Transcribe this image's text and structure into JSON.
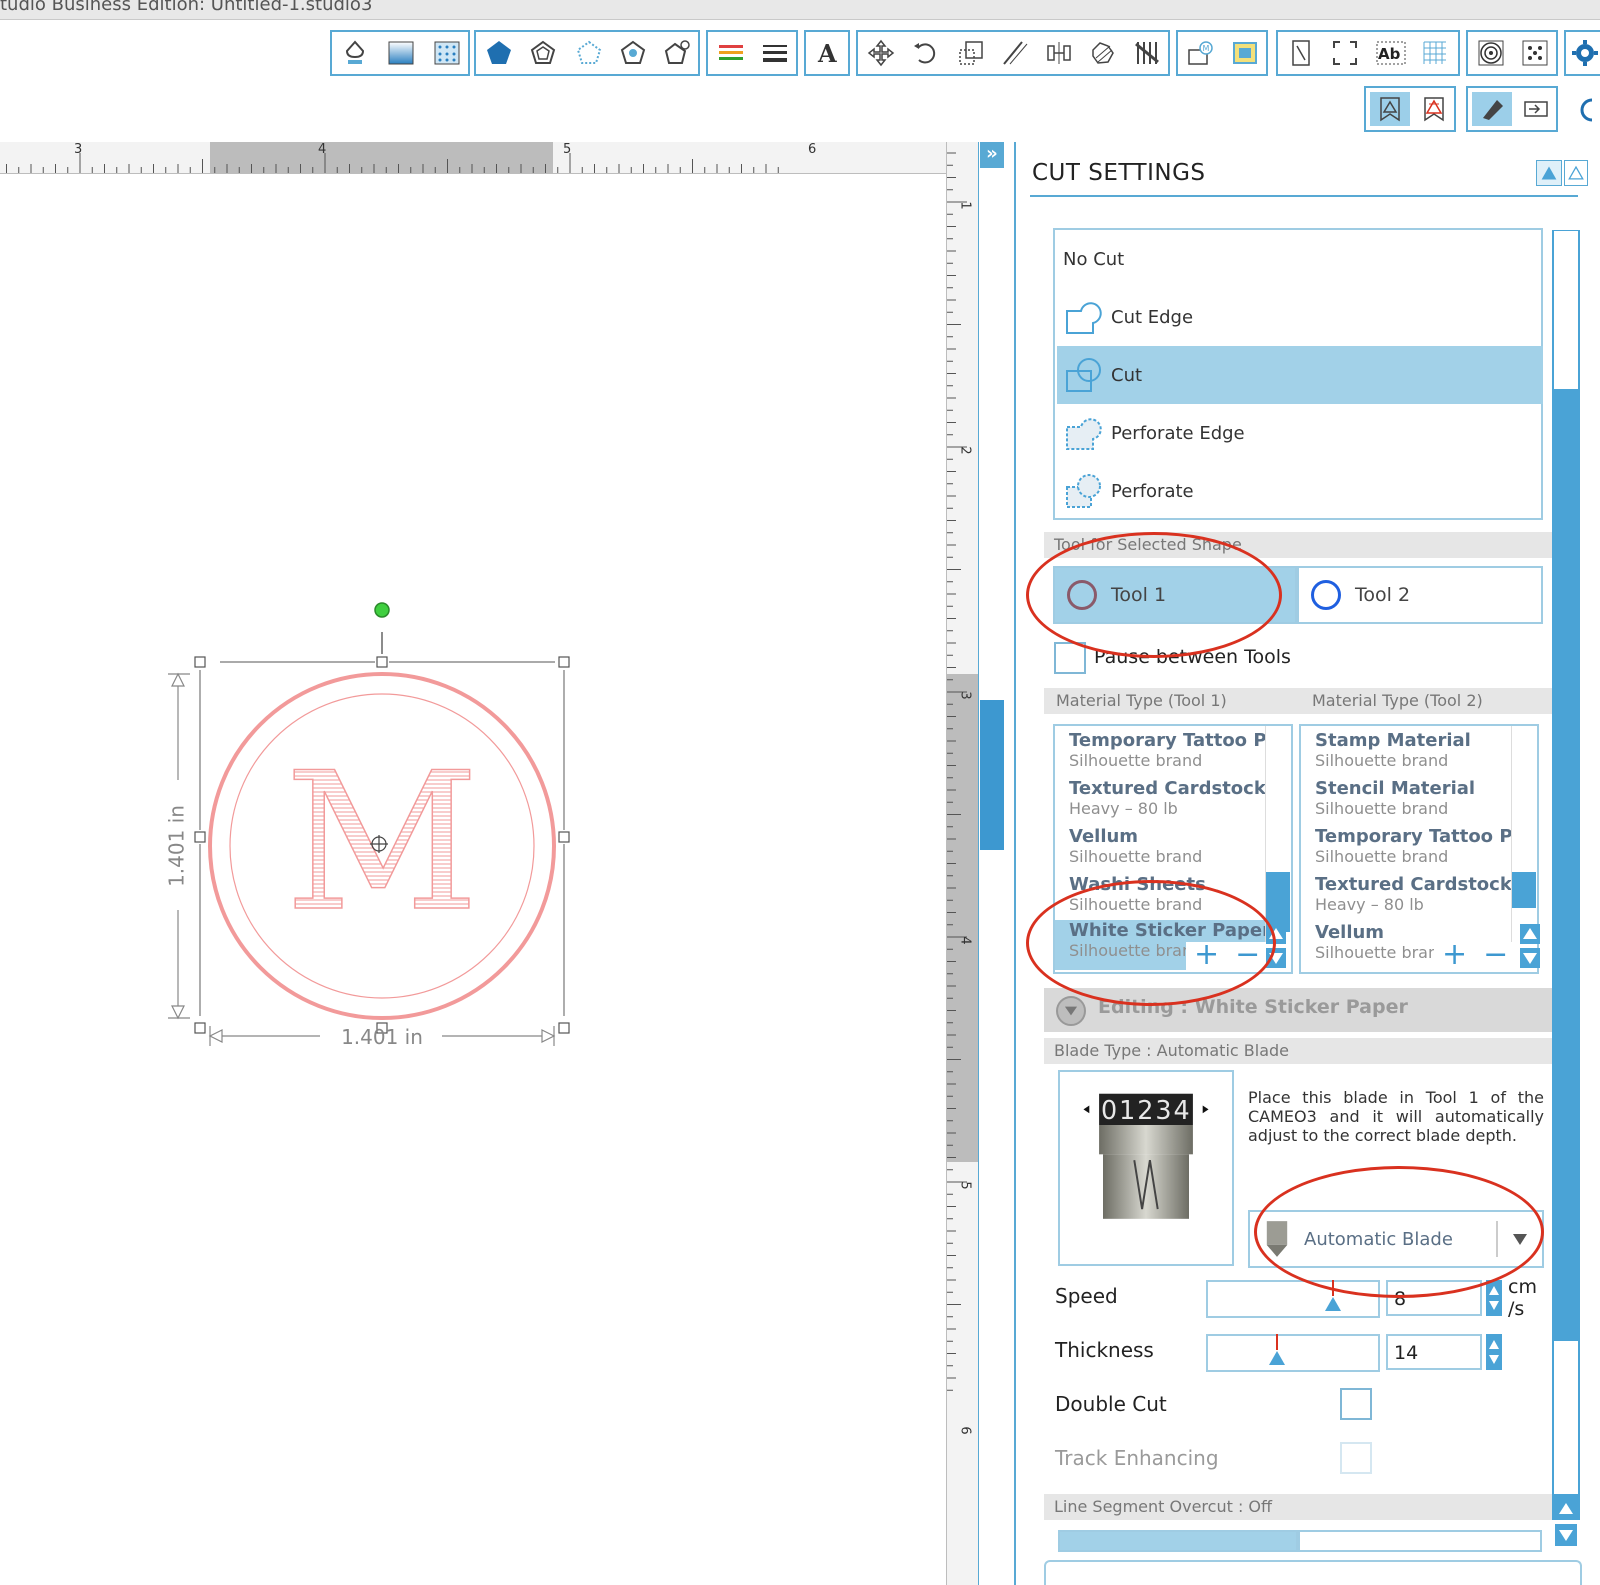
{
  "window": {
    "title": "tudio Business Edition: Untitled-1.studio3"
  },
  "toolbar": {
    "icons": [
      "fill-icon",
      "gradient-icon",
      "pattern-icon",
      "pentagon-icon",
      "layers-icon",
      "offset-icon",
      "trace-icon",
      "replicate-icon",
      "line-color-icon",
      "line-style-icon",
      "text-icon",
      "move-icon",
      "rotate-icon",
      "scale-icon",
      "shear-icon",
      "align-icon",
      "modify-icon",
      "knife-icon",
      "library-icon",
      "image-effects-icon",
      "page-setup-icon",
      "fit-page-icon",
      "text-style-icon",
      "grid-icon",
      "spiral-icon",
      "dots-icon"
    ]
  },
  "ruler": {
    "h_labels": [
      "3",
      "4",
      "5",
      "6"
    ],
    "v_labels": [
      "1",
      "2",
      "3",
      "4",
      "5",
      "6"
    ]
  },
  "canvas": {
    "letter": "M",
    "width_label": "1.401 in",
    "height_label": "1.401 in"
  },
  "panel": {
    "title": "CUT SETTINGS",
    "cut_modes": [
      {
        "label": "No Cut",
        "selected": false
      },
      {
        "label": "Cut Edge",
        "selected": false
      },
      {
        "label": "Cut",
        "selected": true
      },
      {
        "label": "Perforate Edge",
        "selected": false
      },
      {
        "label": "Perforate",
        "selected": false
      }
    ],
    "tool_section": "Tool for Selected Shape",
    "tool1": "Tool 1",
    "tool2": "Tool 2",
    "pause_label": "Pause between Tools",
    "material_label_1": "Material Type (Tool 1)",
    "material_label_2": "Material Type (Tool 2)",
    "materials_1": [
      {
        "name": "Temporary Tattoo Pa",
        "sub": "Silhouette brand"
      },
      {
        "name": "Textured Cardstock",
        "sub": "Heavy – 80 lb"
      },
      {
        "name": "Vellum",
        "sub": "Silhouette brand"
      },
      {
        "name": "Washi Sheets",
        "sub": "Silhouette brand"
      },
      {
        "name": "White Sticker Paper",
        "sub": "Silhouette brar"
      }
    ],
    "materials_2": [
      {
        "name": "Stamp Material",
        "sub": "Silhouette brand"
      },
      {
        "name": "Stencil Material",
        "sub": "Silhouette brand"
      },
      {
        "name": "Temporary Tattoo Pap",
        "sub": "Silhouette brand"
      },
      {
        "name": "Textured Cardstock",
        "sub": "Heavy – 80 lb"
      },
      {
        "name": "Vellum",
        "sub": "Silhouette bran"
      }
    ],
    "editing_label": "Editing : White Sticker Paper",
    "blade_type_label": "Blade Type : Automatic Blade",
    "blade_digits": "01234",
    "blade_desc": "Place this blade in Tool 1 of the CAMEO3 and it will automatically adjust to the correct blade depth.",
    "blade_select": "Automatic Blade",
    "speed_label": "Speed",
    "speed_value": "8",
    "speed_unit_1": "cm",
    "speed_unit_2": "/s",
    "thickness_label": "Thickness",
    "thickness_value": "14",
    "double_cut_label": "Double Cut",
    "track_label": "Track Enhancing",
    "overcut_label": "Line Segment Overcut : Off"
  },
  "colors": {
    "accent": "#58a9d4",
    "selection": "#a2d1e8",
    "shape": "#f29a9a",
    "annotation": "#d9311f"
  }
}
